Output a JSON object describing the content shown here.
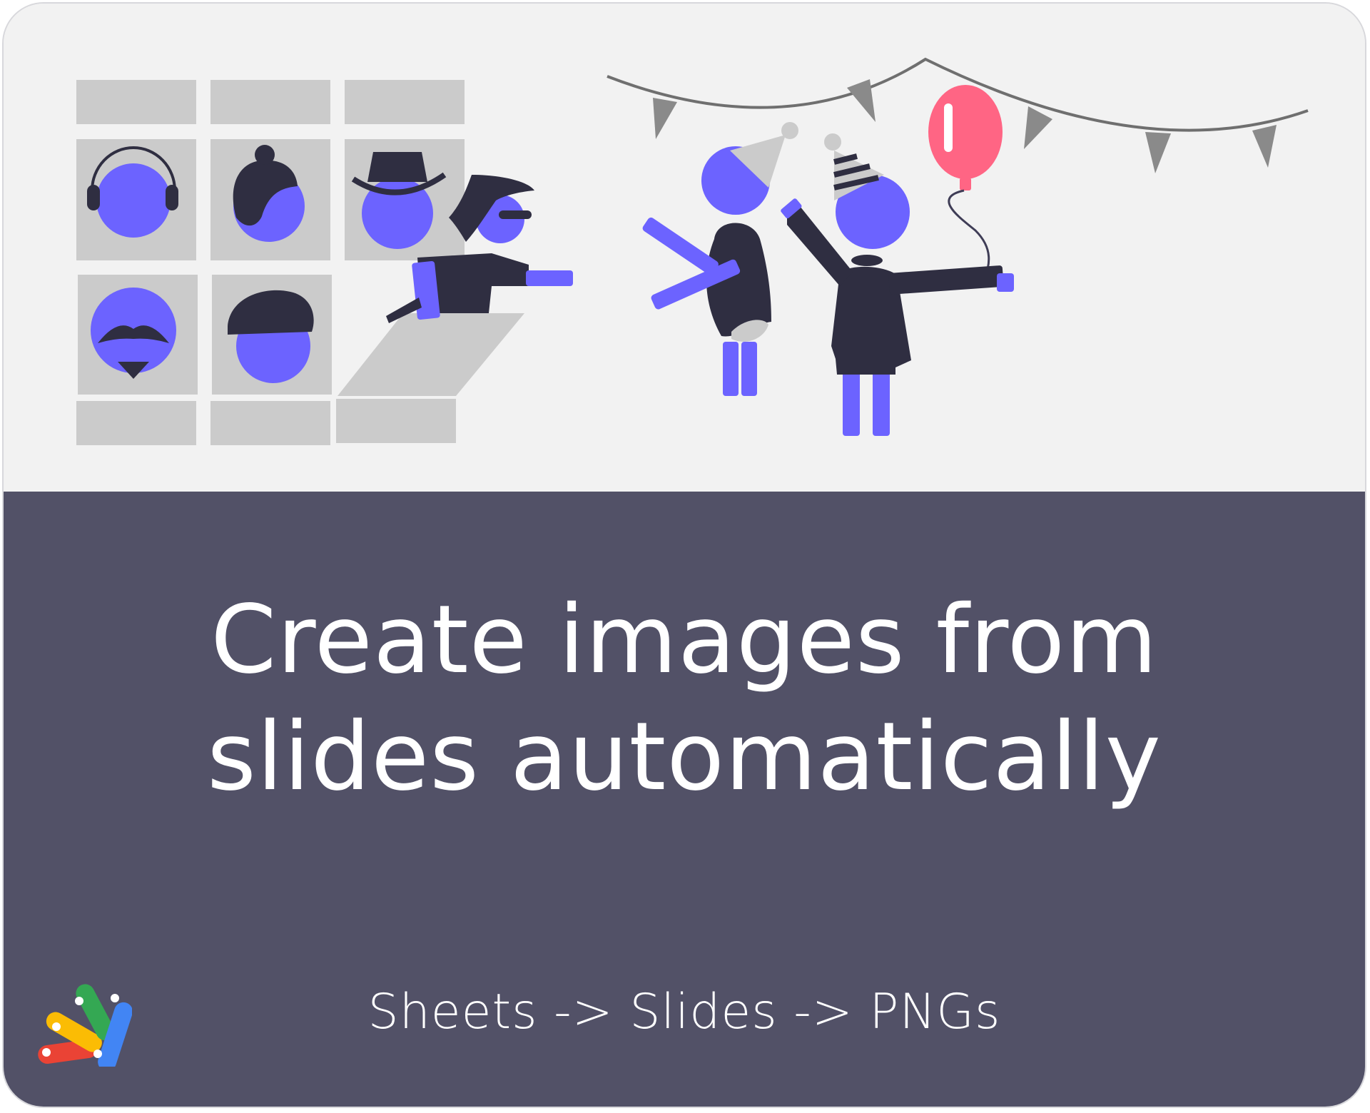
{
  "card": {
    "title_line1": "Create images from",
    "title_line2": "slides automatically",
    "subtitle": "Sheets -> Slides -> PNGs"
  },
  "colors": {
    "background_top": "#f2f2f2",
    "panel": "#525167",
    "text": "#ffffff",
    "accent_purple": "#6c63ff",
    "dark": "#2f2e41",
    "balloon": "#ff6584"
  },
  "icons": {
    "logo": "google-apps-script-logo-icon",
    "illustration": "party-illustration-icon"
  }
}
